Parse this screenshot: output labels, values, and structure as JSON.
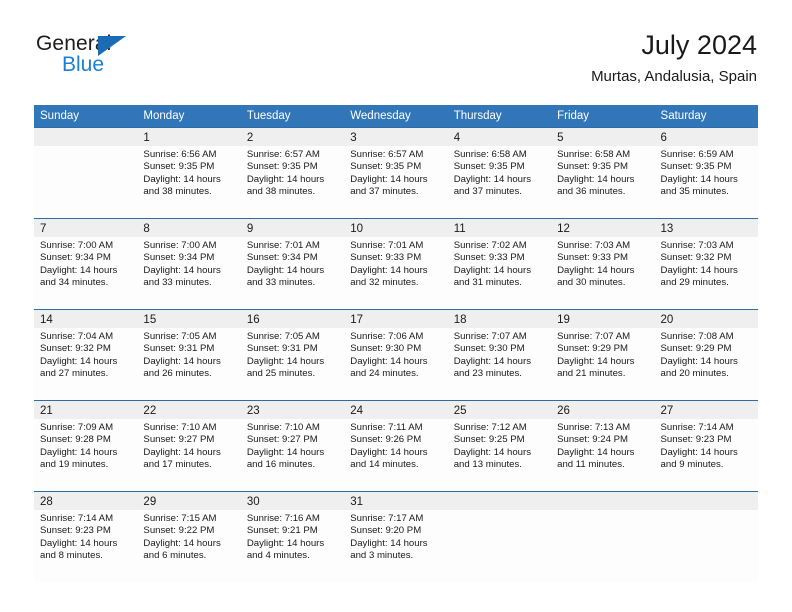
{
  "brand": {
    "name_part1": "General",
    "name_part2": "Blue",
    "triangle_icon": "triangle-icon",
    "color_dark": "#1c1c1c",
    "color_blue": "#1b7fd0"
  },
  "header": {
    "title": "July 2024",
    "location": "Murtas, Andalusia, Spain"
  },
  "theme": {
    "header_blue": "#3176b8",
    "rule_blue": "#2e6da4",
    "date_band": "#efefef",
    "cell_bg": "#fdfdfd",
    "text": "#1a1a1a"
  },
  "calendar": {
    "weekday_headers": [
      "Sunday",
      "Monday",
      "Tuesday",
      "Wednesday",
      "Thursday",
      "Friday",
      "Saturday"
    ],
    "weeks": [
      [
        {
          "day": "",
          "sunrise": "",
          "sunset": "",
          "daylight1": "",
          "daylight2": ""
        },
        {
          "day": "1",
          "sunrise": "Sunrise: 6:56 AM",
          "sunset": "Sunset: 9:35 PM",
          "daylight1": "Daylight: 14 hours",
          "daylight2": "and 38 minutes."
        },
        {
          "day": "2",
          "sunrise": "Sunrise: 6:57 AM",
          "sunset": "Sunset: 9:35 PM",
          "daylight1": "Daylight: 14 hours",
          "daylight2": "and 38 minutes."
        },
        {
          "day": "3",
          "sunrise": "Sunrise: 6:57 AM",
          "sunset": "Sunset: 9:35 PM",
          "daylight1": "Daylight: 14 hours",
          "daylight2": "and 37 minutes."
        },
        {
          "day": "4",
          "sunrise": "Sunrise: 6:58 AM",
          "sunset": "Sunset: 9:35 PM",
          "daylight1": "Daylight: 14 hours",
          "daylight2": "and 37 minutes."
        },
        {
          "day": "5",
          "sunrise": "Sunrise: 6:58 AM",
          "sunset": "Sunset: 9:35 PM",
          "daylight1": "Daylight: 14 hours",
          "daylight2": "and 36 minutes."
        },
        {
          "day": "6",
          "sunrise": "Sunrise: 6:59 AM",
          "sunset": "Sunset: 9:35 PM",
          "daylight1": "Daylight: 14 hours",
          "daylight2": "and 35 minutes."
        }
      ],
      [
        {
          "day": "7",
          "sunrise": "Sunrise: 7:00 AM",
          "sunset": "Sunset: 9:34 PM",
          "daylight1": "Daylight: 14 hours",
          "daylight2": "and 34 minutes."
        },
        {
          "day": "8",
          "sunrise": "Sunrise: 7:00 AM",
          "sunset": "Sunset: 9:34 PM",
          "daylight1": "Daylight: 14 hours",
          "daylight2": "and 33 minutes."
        },
        {
          "day": "9",
          "sunrise": "Sunrise: 7:01 AM",
          "sunset": "Sunset: 9:34 PM",
          "daylight1": "Daylight: 14 hours",
          "daylight2": "and 33 minutes."
        },
        {
          "day": "10",
          "sunrise": "Sunrise: 7:01 AM",
          "sunset": "Sunset: 9:33 PM",
          "daylight1": "Daylight: 14 hours",
          "daylight2": "and 32 minutes."
        },
        {
          "day": "11",
          "sunrise": "Sunrise: 7:02 AM",
          "sunset": "Sunset: 9:33 PM",
          "daylight1": "Daylight: 14 hours",
          "daylight2": "and 31 minutes."
        },
        {
          "day": "12",
          "sunrise": "Sunrise: 7:03 AM",
          "sunset": "Sunset: 9:33 PM",
          "daylight1": "Daylight: 14 hours",
          "daylight2": "and 30 minutes."
        },
        {
          "day": "13",
          "sunrise": "Sunrise: 7:03 AM",
          "sunset": "Sunset: 9:32 PM",
          "daylight1": "Daylight: 14 hours",
          "daylight2": "and 29 minutes."
        }
      ],
      [
        {
          "day": "14",
          "sunrise": "Sunrise: 7:04 AM",
          "sunset": "Sunset: 9:32 PM",
          "daylight1": "Daylight: 14 hours",
          "daylight2": "and 27 minutes."
        },
        {
          "day": "15",
          "sunrise": "Sunrise: 7:05 AM",
          "sunset": "Sunset: 9:31 PM",
          "daylight1": "Daylight: 14 hours",
          "daylight2": "and 26 minutes."
        },
        {
          "day": "16",
          "sunrise": "Sunrise: 7:05 AM",
          "sunset": "Sunset: 9:31 PM",
          "daylight1": "Daylight: 14 hours",
          "daylight2": "and 25 minutes."
        },
        {
          "day": "17",
          "sunrise": "Sunrise: 7:06 AM",
          "sunset": "Sunset: 9:30 PM",
          "daylight1": "Daylight: 14 hours",
          "daylight2": "and 24 minutes."
        },
        {
          "day": "18",
          "sunrise": "Sunrise: 7:07 AM",
          "sunset": "Sunset: 9:30 PM",
          "daylight1": "Daylight: 14 hours",
          "daylight2": "and 23 minutes."
        },
        {
          "day": "19",
          "sunrise": "Sunrise: 7:07 AM",
          "sunset": "Sunset: 9:29 PM",
          "daylight1": "Daylight: 14 hours",
          "daylight2": "and 21 minutes."
        },
        {
          "day": "20",
          "sunrise": "Sunrise: 7:08 AM",
          "sunset": "Sunset: 9:29 PM",
          "daylight1": "Daylight: 14 hours",
          "daylight2": "and 20 minutes."
        }
      ],
      [
        {
          "day": "21",
          "sunrise": "Sunrise: 7:09 AM",
          "sunset": "Sunset: 9:28 PM",
          "daylight1": "Daylight: 14 hours",
          "daylight2": "and 19 minutes."
        },
        {
          "day": "22",
          "sunrise": "Sunrise: 7:10 AM",
          "sunset": "Sunset: 9:27 PM",
          "daylight1": "Daylight: 14 hours",
          "daylight2": "and 17 minutes."
        },
        {
          "day": "23",
          "sunrise": "Sunrise: 7:10 AM",
          "sunset": "Sunset: 9:27 PM",
          "daylight1": "Daylight: 14 hours",
          "daylight2": "and 16 minutes."
        },
        {
          "day": "24",
          "sunrise": "Sunrise: 7:11 AM",
          "sunset": "Sunset: 9:26 PM",
          "daylight1": "Daylight: 14 hours",
          "daylight2": "and 14 minutes."
        },
        {
          "day": "25",
          "sunrise": "Sunrise: 7:12 AM",
          "sunset": "Sunset: 9:25 PM",
          "daylight1": "Daylight: 14 hours",
          "daylight2": "and 13 minutes."
        },
        {
          "day": "26",
          "sunrise": "Sunrise: 7:13 AM",
          "sunset": "Sunset: 9:24 PM",
          "daylight1": "Daylight: 14 hours",
          "daylight2": "and 11 minutes."
        },
        {
          "day": "27",
          "sunrise": "Sunrise: 7:14 AM",
          "sunset": "Sunset: 9:23 PM",
          "daylight1": "Daylight: 14 hours",
          "daylight2": "and 9 minutes."
        }
      ],
      [
        {
          "day": "28",
          "sunrise": "Sunrise: 7:14 AM",
          "sunset": "Sunset: 9:23 PM",
          "daylight1": "Daylight: 14 hours",
          "daylight2": "and 8 minutes."
        },
        {
          "day": "29",
          "sunrise": "Sunrise: 7:15 AM",
          "sunset": "Sunset: 9:22 PM",
          "daylight1": "Daylight: 14 hours",
          "daylight2": "and 6 minutes."
        },
        {
          "day": "30",
          "sunrise": "Sunrise: 7:16 AM",
          "sunset": "Sunset: 9:21 PM",
          "daylight1": "Daylight: 14 hours",
          "daylight2": "and 4 minutes."
        },
        {
          "day": "31",
          "sunrise": "Sunrise: 7:17 AM",
          "sunset": "Sunset: 9:20 PM",
          "daylight1": "Daylight: 14 hours",
          "daylight2": "and 3 minutes."
        },
        {
          "day": "",
          "sunrise": "",
          "sunset": "",
          "daylight1": "",
          "daylight2": ""
        },
        {
          "day": "",
          "sunrise": "",
          "sunset": "",
          "daylight1": "",
          "daylight2": ""
        },
        {
          "day": "",
          "sunrise": "",
          "sunset": "",
          "daylight1": "",
          "daylight2": ""
        }
      ]
    ]
  }
}
